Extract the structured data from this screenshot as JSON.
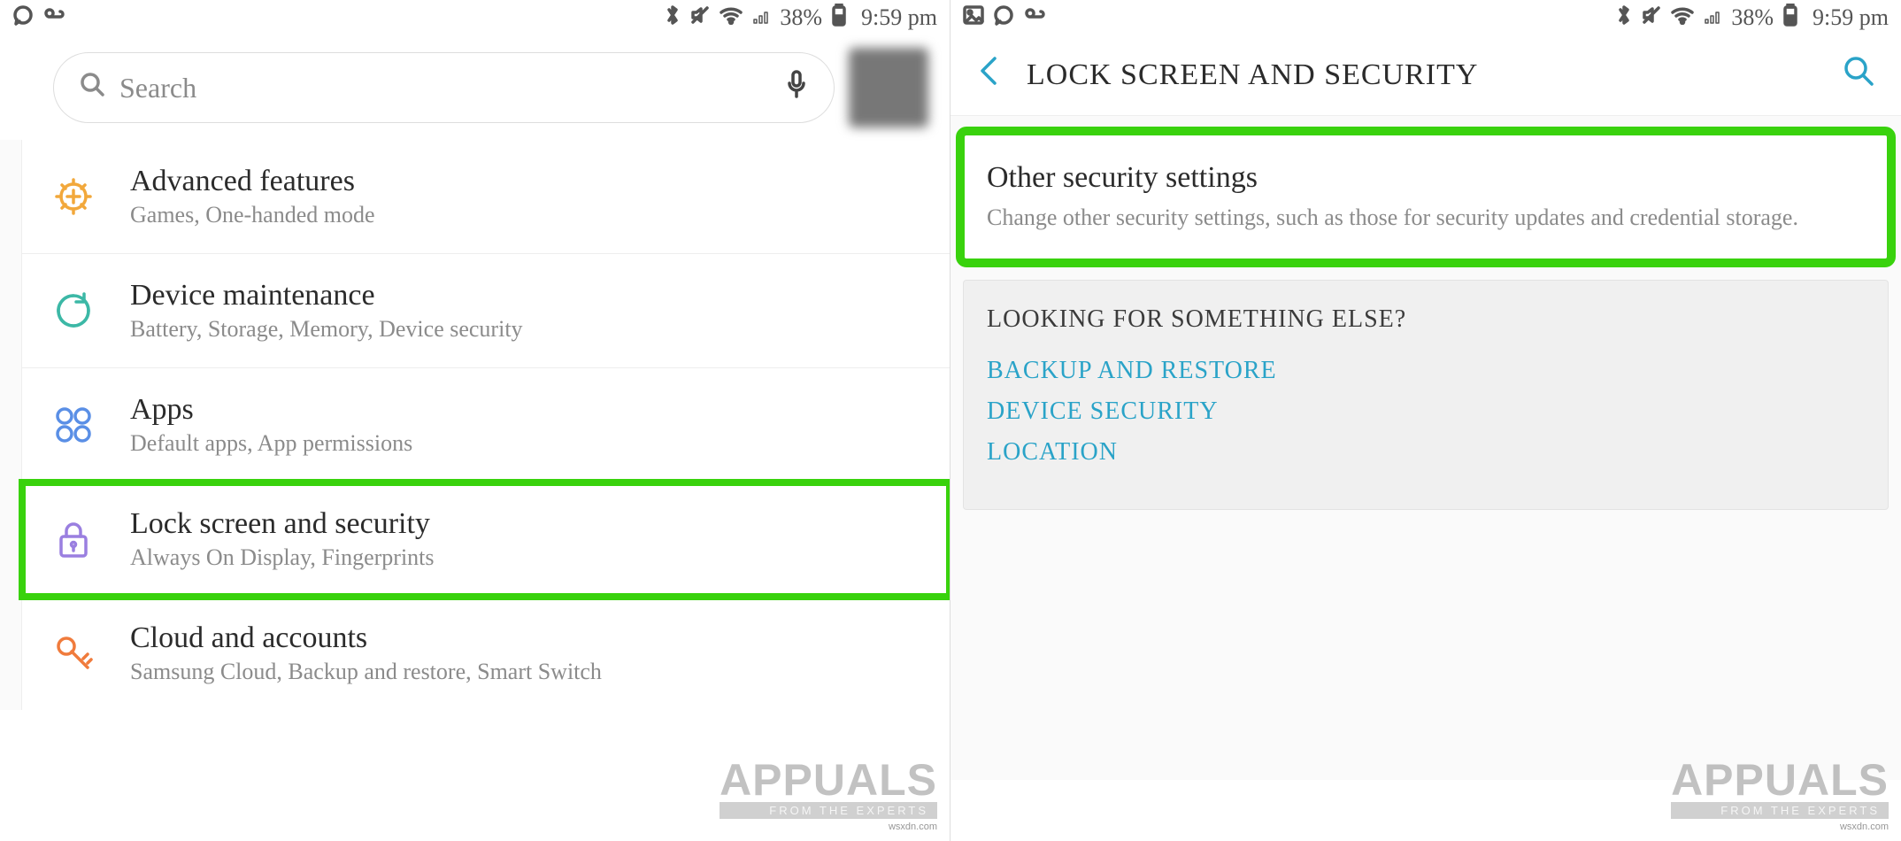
{
  "status": {
    "battery_pct": "38%",
    "time": "9:59 pm"
  },
  "left": {
    "search_placeholder": "Search",
    "items": [
      {
        "icon": "plus-gear",
        "title": "Advanced features",
        "subtitle": "Games, One-handed mode"
      },
      {
        "icon": "refresh",
        "title": "Device maintenance",
        "subtitle": "Battery, Storage, Memory, Device security"
      },
      {
        "icon": "apps-grid",
        "title": "Apps",
        "subtitle": "Default apps, App permissions"
      },
      {
        "icon": "lock",
        "title": "Lock screen and security",
        "subtitle": "Always On Display, Fingerprints",
        "highlight": true
      },
      {
        "icon": "key",
        "title": "Cloud and accounts",
        "subtitle": "Samsung Cloud, Backup and restore, Smart Switch"
      }
    ]
  },
  "right": {
    "header_title": "LOCK SCREEN AND SECURITY",
    "other": {
      "title": "Other security settings",
      "desc": "Change other security settings, such as those for security updates and credential storage."
    },
    "else": {
      "heading": "LOOKING FOR SOMETHING ELSE?",
      "links": [
        "BACKUP AND RESTORE",
        "DEVICE SECURITY",
        "LOCATION"
      ]
    }
  },
  "watermark": {
    "brand": "APPUALS",
    "tagline": "FROM THE EXPERTS",
    "source": "wsxdn.com"
  }
}
